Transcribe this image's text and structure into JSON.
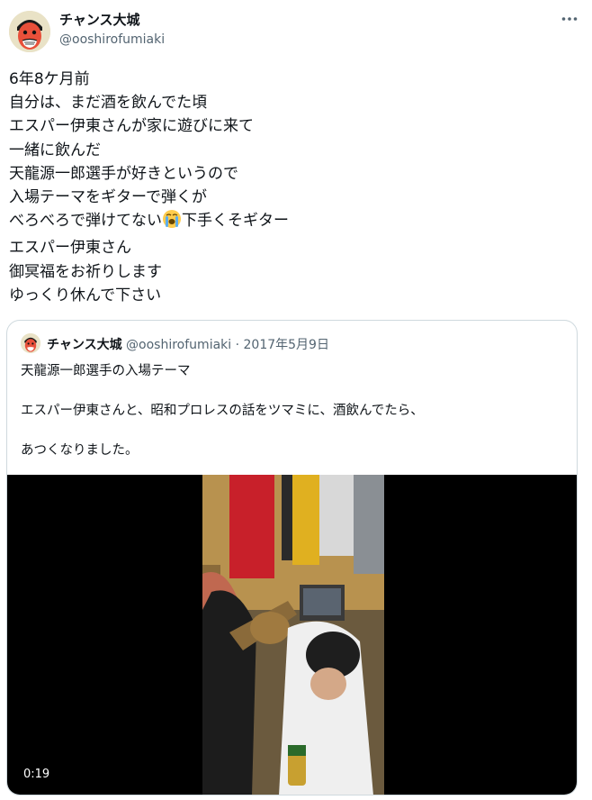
{
  "author": {
    "display_name": "チャンス大城",
    "handle": "@ooshirofumiaki"
  },
  "icons": {
    "more": "more-horizontal-icon",
    "emoji": "loudly-crying-face-emoji"
  },
  "tweet": {
    "lines": [
      "6年8ケ月前",
      "自分は、まだ酒を飲んでた頃",
      "エスパー伊東さんが家に遊びに来て",
      "一緒に飲んだ",
      "天龍源一郎選手が好きというので",
      "入場テーマをギターで弾くが"
    ],
    "line7_before": "べろべろで弾けてない",
    "line7_after": "下手くそギター",
    "lines_end": [
      "エスパー伊東さん",
      "御冥福をお祈りします",
      "ゆっくり休んで下さい"
    ]
  },
  "quote": {
    "display_name": "チャンス大城",
    "handle": "@ooshirofumiaki",
    "separator": "·",
    "date": "2017年5月9日",
    "lines": [
      "天龍源一郎選手の入場テーマ",
      "エスパー伊東さんと、昭和プロレスの話をツマミに、酒飲んでたら、",
      "あつくなりました。"
    ],
    "video_duration": "0:19"
  },
  "colors": {
    "text": "#0f1419",
    "secondary": "#536471",
    "border": "#cfd9de",
    "media_bg": "#000000"
  }
}
